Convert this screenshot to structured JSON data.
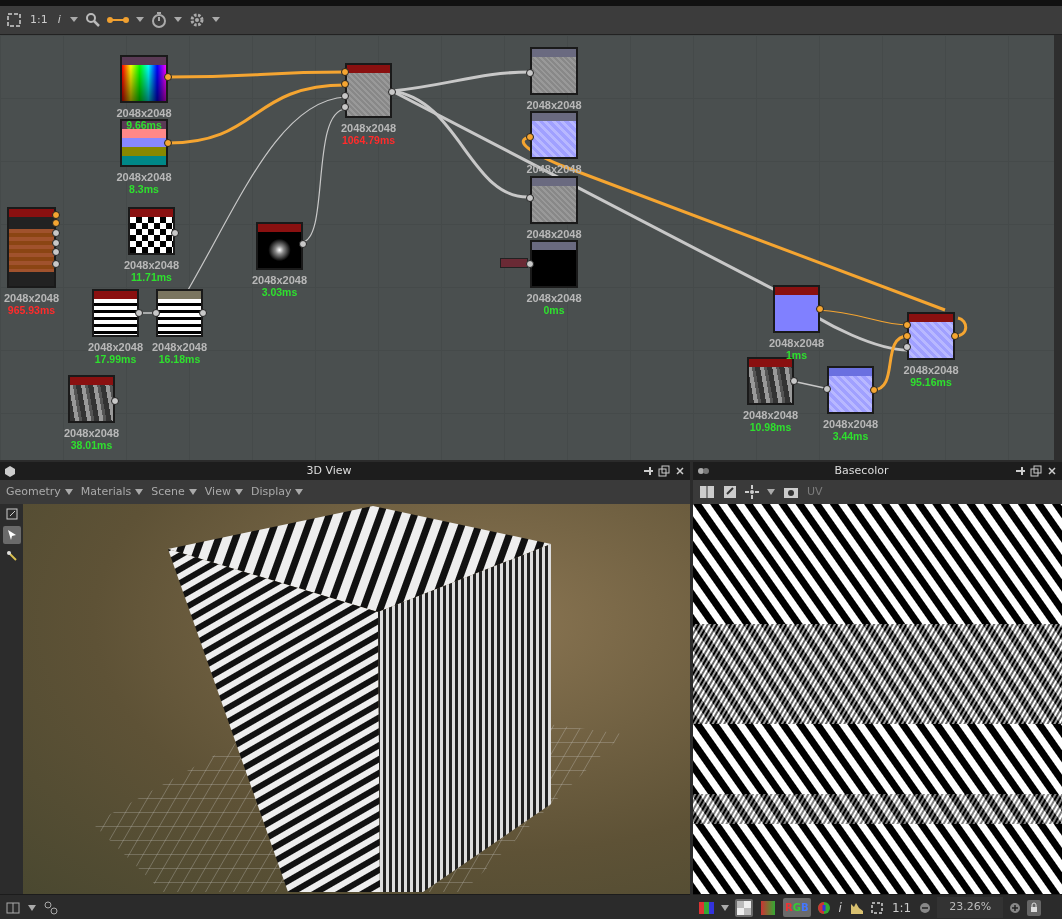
{
  "graph_toolbar": {
    "actual_size": "1:1",
    "info": "i"
  },
  "nodes": [
    {
      "color": "#6a6a80",
      "kind": "grey",
      "resolution": "2048x2048"
    },
    {
      "color": "#5a3a55",
      "kind": "spectrum",
      "resolution": "2048x2048",
      "timing": "9.66ms",
      "slow": false
    },
    {
      "color": "#8a1010",
      "kind": "grey",
      "resolution": "2048x2048",
      "timing": "1064.79ms",
      "slow": true
    },
    {
      "color": "#6a6a80",
      "kind": "normal",
      "resolution": "2048x2048"
    },
    {
      "color": "#5a3a55",
      "kind": "colorbars",
      "resolution": "2048x2048",
      "timing": "8.3ms",
      "slow": false
    },
    {
      "color": "#6a6a80",
      "kind": "grey",
      "resolution": "2048x2048"
    },
    {
      "color": "#8a1010",
      "kind": "wood",
      "resolution": "2048x2048",
      "timing": "965.93ms",
      "slow": true
    },
    {
      "color": "#8a1010",
      "kind": "checker",
      "resolution": "2048x2048",
      "timing": "11.71ms",
      "slow": false
    },
    {
      "color": "#8a1010",
      "kind": "glow",
      "resolution": "2048x2048",
      "timing": "3.03ms",
      "slow": false
    },
    {
      "color": "#6a6a80",
      "kind": "black",
      "resolution": "2048x2048",
      "timing": "0ms",
      "slow": false
    },
    {
      "color": "#8a1010",
      "kind": "stripes",
      "resolution": "2048x2048",
      "timing": "17.99ms",
      "slow": false
    },
    {
      "color": "#7a7560",
      "kind": "stripes",
      "resolution": "2048x2048",
      "timing": "16.18ms",
      "slow": false
    },
    {
      "color": "#8a1010",
      "kind": "flatnormal",
      "resolution": "2048x2048",
      "timing": "1ms",
      "slow": false
    },
    {
      "color": "#8a1010",
      "kind": "normal",
      "resolution": "2048x2048",
      "timing": "95.16ms",
      "slow": false
    },
    {
      "color": "#8a1010",
      "kind": "noise",
      "resolution": "2048x2048",
      "timing": "10.98ms",
      "slow": false
    },
    {
      "color": "#6a70e0",
      "kind": "normal",
      "resolution": "2048x2048",
      "timing": "3.44ms",
      "slow": false
    },
    {
      "color": "#8a1010",
      "kind": "noise",
      "resolution": "2048x2048",
      "timing": "38.01ms",
      "slow": false
    }
  ],
  "view3d": {
    "title": "3D View",
    "menus": [
      "Geometry",
      "Materials",
      "Scene",
      "View",
      "Display"
    ]
  },
  "view2d": {
    "title": "Basecolor",
    "uv_label": "UV",
    "uv_disabled": true,
    "checker_toggle": {
      "selected": true
    },
    "gradient_toggle": {
      "selected": false
    },
    "rgb_toggle": {
      "label": "RGB",
      "selected": true
    },
    "info": "i",
    "actual_size": "1:1",
    "zoom": "23.26%"
  }
}
